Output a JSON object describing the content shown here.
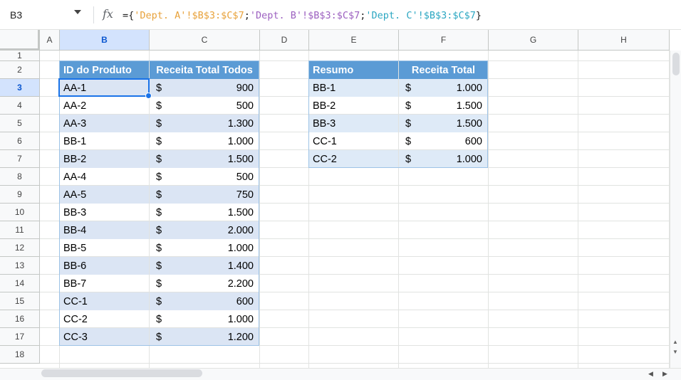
{
  "formula_bar": {
    "cell_ref": "B3",
    "fx": "fx",
    "formula_parts": [
      "={",
      "'Dept. A'!$B$3:$C$7",
      ";",
      "'Dept. B'!$B$3:$C$7",
      ";",
      "'Dept. C'!$B$3:$C$7",
      "}"
    ]
  },
  "columns": [
    "A",
    "B",
    "C",
    "D",
    "E",
    "F",
    "G",
    "H"
  ],
  "rows": [
    "1",
    "2",
    "3",
    "4",
    "5",
    "6",
    "7",
    "8",
    "9",
    "10",
    "11",
    "12",
    "13",
    "14",
    "15",
    "16",
    "17",
    "18"
  ],
  "selected_cell": "B3",
  "table_left": {
    "headers": [
      "ID do Produto",
      "Receita Total Todos"
    ],
    "currency_symbol": "$",
    "rows": [
      {
        "id": "AA-1",
        "value": "900"
      },
      {
        "id": "AA-2",
        "value": "500"
      },
      {
        "id": "AA-3",
        "value": "1.300"
      },
      {
        "id": "BB-1",
        "value": "1.000"
      },
      {
        "id": "BB-2",
        "value": "1.500"
      },
      {
        "id": "AA-4",
        "value": "500"
      },
      {
        "id": "AA-5",
        "value": "750"
      },
      {
        "id": "BB-3",
        "value": "1.500"
      },
      {
        "id": "BB-4",
        "value": "2.000"
      },
      {
        "id": "BB-5",
        "value": "1.000"
      },
      {
        "id": "BB-6",
        "value": "1.400"
      },
      {
        "id": "BB-7",
        "value": "2.200"
      },
      {
        "id": "CC-1",
        "value": "600"
      },
      {
        "id": "CC-2",
        "value": "1.000"
      },
      {
        "id": "CC-3",
        "value": "1.200"
      }
    ]
  },
  "table_right": {
    "headers": [
      "Resumo",
      "Receita Total"
    ],
    "currency_symbol": "$",
    "rows": [
      {
        "id": "BB-1",
        "value": "1.000"
      },
      {
        "id": "BB-2",
        "value": "1.500"
      },
      {
        "id": "BB-3",
        "value": "1.500"
      },
      {
        "id": "CC-1",
        "value": "600"
      },
      {
        "id": "CC-2",
        "value": "1.000"
      }
    ]
  },
  "colors": {
    "header_fill": "#5b9bd5",
    "band_fill": "#dbe5f4",
    "selection": "#1a73e8"
  }
}
